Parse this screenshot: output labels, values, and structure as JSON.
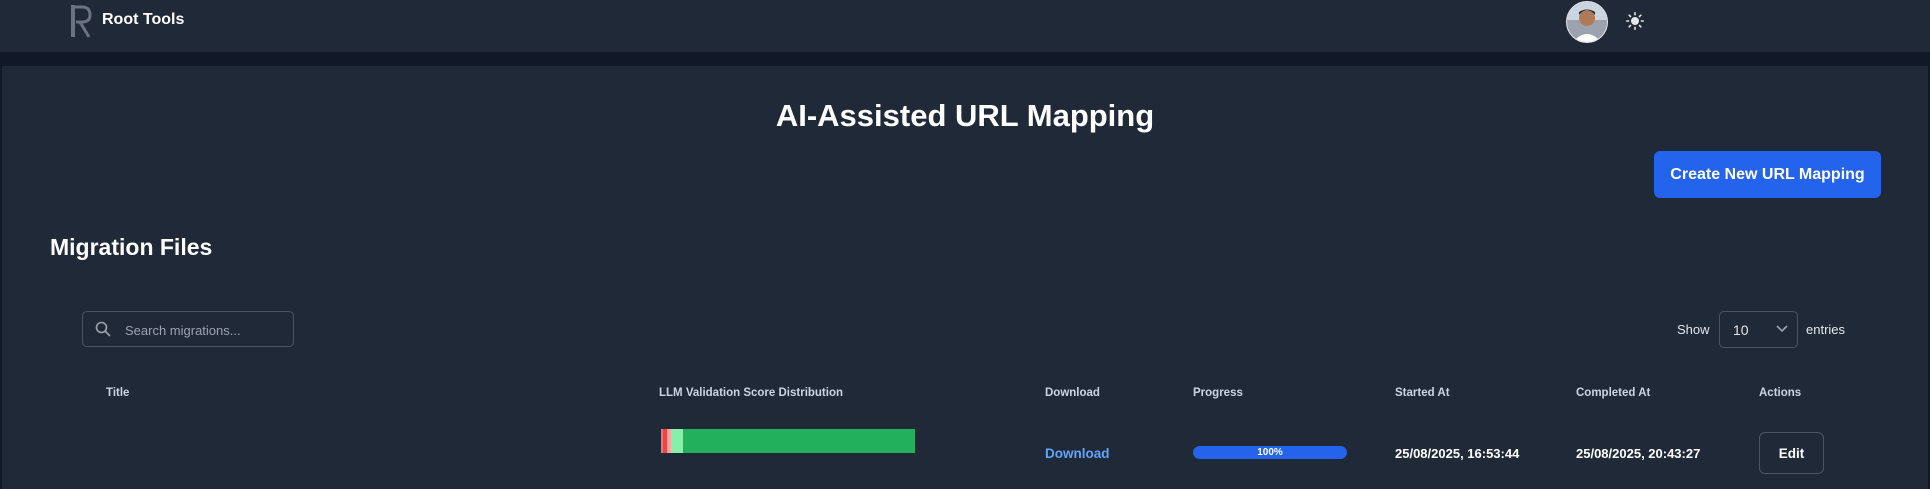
{
  "app": {
    "brand": "Root Tools"
  },
  "page": {
    "title": "AI-Assisted URL Mapping",
    "create_button": "Create New URL Mapping"
  },
  "section": {
    "title": "Migration Files"
  },
  "search": {
    "placeholder": "Search migrations...",
    "value": ""
  },
  "entries": {
    "show_label": "Show",
    "value": "10",
    "entries_label": "entries"
  },
  "table": {
    "headers": [
      "Title",
      "LLM Validation Score Distribution",
      "Download",
      "Progress",
      "Started At",
      "Completed At",
      "Actions"
    ],
    "rows": [
      {
        "title": "",
        "download_label": "Download",
        "progress_label": "100%",
        "progress_fraction": 1.0,
        "started_at": "25/08/2025, 16:53:44",
        "completed_at": "25/08/2025, 20:43:27",
        "action_label": "Edit",
        "score_distribution": [
          {
            "color": "#f87171",
            "fraction": 0.008
          },
          {
            "color": "#ef4444",
            "fraction": 0.016
          },
          {
            "color": "#fca5a5",
            "fraction": 0.016
          },
          {
            "color": "#86efac",
            "fraction": 0.047
          },
          {
            "color": "#22b05c",
            "fraction": 0.913
          }
        ]
      }
    ]
  },
  "colors": {
    "accent": "#2463eb",
    "link": "#60a5fa",
    "background": "#202938",
    "success": "#22b05c"
  },
  "icons": {
    "logo": "root-tools-logo-icon",
    "theme": "sun-icon",
    "search": "search-icon",
    "select": "chevron-down-icon"
  }
}
